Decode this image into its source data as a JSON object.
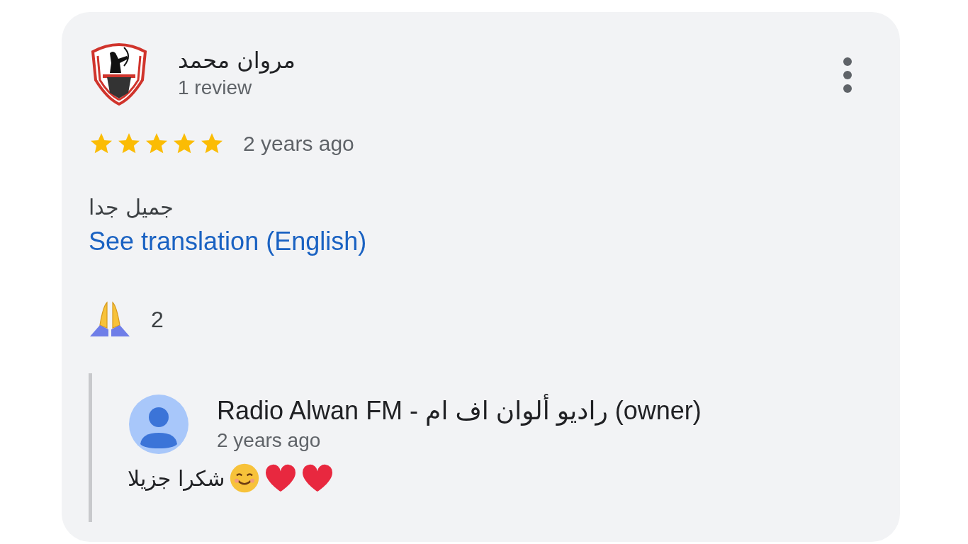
{
  "review": {
    "author": "مروان محمد",
    "author_meta": "1 review",
    "stars": 5,
    "date": "2 years ago",
    "text": "جميل جدا",
    "translate_link": "See translation (English)",
    "reactions": [
      {
        "kind": "pray",
        "count": "2"
      }
    ],
    "owner_reply": {
      "author": "Radio Alwan FM - راديو ألوان اف ام (owner)",
      "date": "2 years ago",
      "text": "شكرا جزيلا",
      "emojis": [
        {
          "kind": "smile"
        },
        {
          "kind": "heart"
        },
        {
          "kind": "heart"
        }
      ]
    }
  }
}
